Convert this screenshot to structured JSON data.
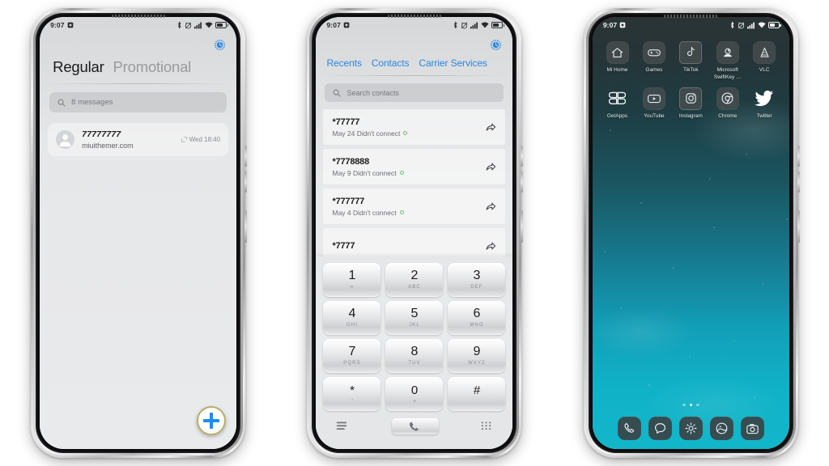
{
  "statusbar": {
    "time": "9:07",
    "icons": [
      "dnd-square-icon",
      "bluetooth-icon",
      "alarm-off-icon",
      "signal-bars-icon",
      "wifi-icon",
      "battery-icon"
    ]
  },
  "phone1": {
    "name": "messages-app",
    "gear_icon": "settings-gear-icon",
    "tabs": [
      {
        "label": "Regular",
        "active": true
      },
      {
        "label": "Promotional",
        "active": false
      }
    ],
    "search": {
      "placeholder": "8 messages",
      "icon": "search-icon"
    },
    "messages": [
      {
        "title": "77777777",
        "preview": "miuithemer.com",
        "time": "Wed 18:40",
        "meta_icon": "sent-report-icon",
        "avatar": "contact-avatar"
      }
    ],
    "fab": {
      "icon": "plus-icon",
      "color": "#1d8bf1",
      "ring_color": "#b8ac6a"
    }
  },
  "phone2": {
    "name": "dialer-app",
    "gear_icon": "settings-gear-icon",
    "tabs": [
      {
        "label": "Recents"
      },
      {
        "label": "Contacts"
      },
      {
        "label": "Carrier Services"
      }
    ],
    "tab_color": "#2a87e0",
    "search": {
      "placeholder": "Search contacts",
      "icon": "search-icon"
    },
    "calls": [
      {
        "number": "*77777",
        "detail": "May 24 Didn't connect",
        "status_dot": "#6ec06e",
        "action_icon": "share-arrow-icon"
      },
      {
        "number": "*7778888",
        "detail": "May 9 Didn't connect",
        "status_dot": "#6ec06e",
        "action_icon": "share-arrow-icon"
      },
      {
        "number": "*777777",
        "detail": "May 4 Didn't connect",
        "status_dot": "#6ec06e",
        "action_icon": "share-arrow-icon"
      },
      {
        "number": "*7777",
        "detail": "",
        "status_dot": "#6ec06e",
        "action_icon": "share-arrow-icon"
      }
    ],
    "keypad": [
      {
        "digit": "1",
        "letters": "∞"
      },
      {
        "digit": "2",
        "letters": "ABC"
      },
      {
        "digit": "3",
        "letters": "DEF"
      },
      {
        "digit": "4",
        "letters": "GHI"
      },
      {
        "digit": "5",
        "letters": "JKL"
      },
      {
        "digit": "6",
        "letters": "MNO"
      },
      {
        "digit": "7",
        "letters": "PQRS"
      },
      {
        "digit": "8",
        "letters": "TUV"
      },
      {
        "digit": "9",
        "letters": "WXYZ"
      },
      {
        "digit": "*",
        "letters": "'"
      },
      {
        "digit": "0",
        "letters": "+"
      },
      {
        "digit": "#",
        "letters": ""
      }
    ],
    "actions": {
      "list_icon": "call-log-list-icon",
      "call_icon": "call-handset-icon",
      "keypad_icon": "keypad-grid-icon"
    }
  },
  "phone3": {
    "name": "home-screen",
    "apps": [
      {
        "label": "Mi Home",
        "icon": "home-icon"
      },
      {
        "label": "Games",
        "icon": "gamepad-icon"
      },
      {
        "label": "TikTok",
        "icon": "tiktok-note-icon"
      },
      {
        "label": "Microsoft SwiftKey …",
        "icon": "swiftkey-icon"
      },
      {
        "label": "VLC",
        "icon": "vlc-cone-icon"
      },
      {
        "label": "GetApps",
        "icon": "getapps-quad-icon"
      },
      {
        "label": "YouTube",
        "icon": "youtube-play-icon"
      },
      {
        "label": "Instagram",
        "icon": "instagram-camera-icon"
      },
      {
        "label": "Chrome",
        "icon": "chrome-icon"
      },
      {
        "label": "Twitter",
        "icon": "twitter-bird-icon"
      }
    ],
    "page_dots": {
      "count": 3,
      "active_index": 1
    },
    "dock": [
      {
        "icon": "phone-handset-icon",
        "label": "Phone"
      },
      {
        "icon": "message-bubble-icon",
        "label": "Messages"
      },
      {
        "icon": "settings-gear-icon",
        "label": "Settings"
      },
      {
        "icon": "gallery-icon",
        "label": "Gallery"
      },
      {
        "icon": "camera-icon",
        "label": "Camera"
      }
    ],
    "wallpaper": {
      "top_color": "#2b3335",
      "bottom_color": "#12b6c9"
    }
  }
}
